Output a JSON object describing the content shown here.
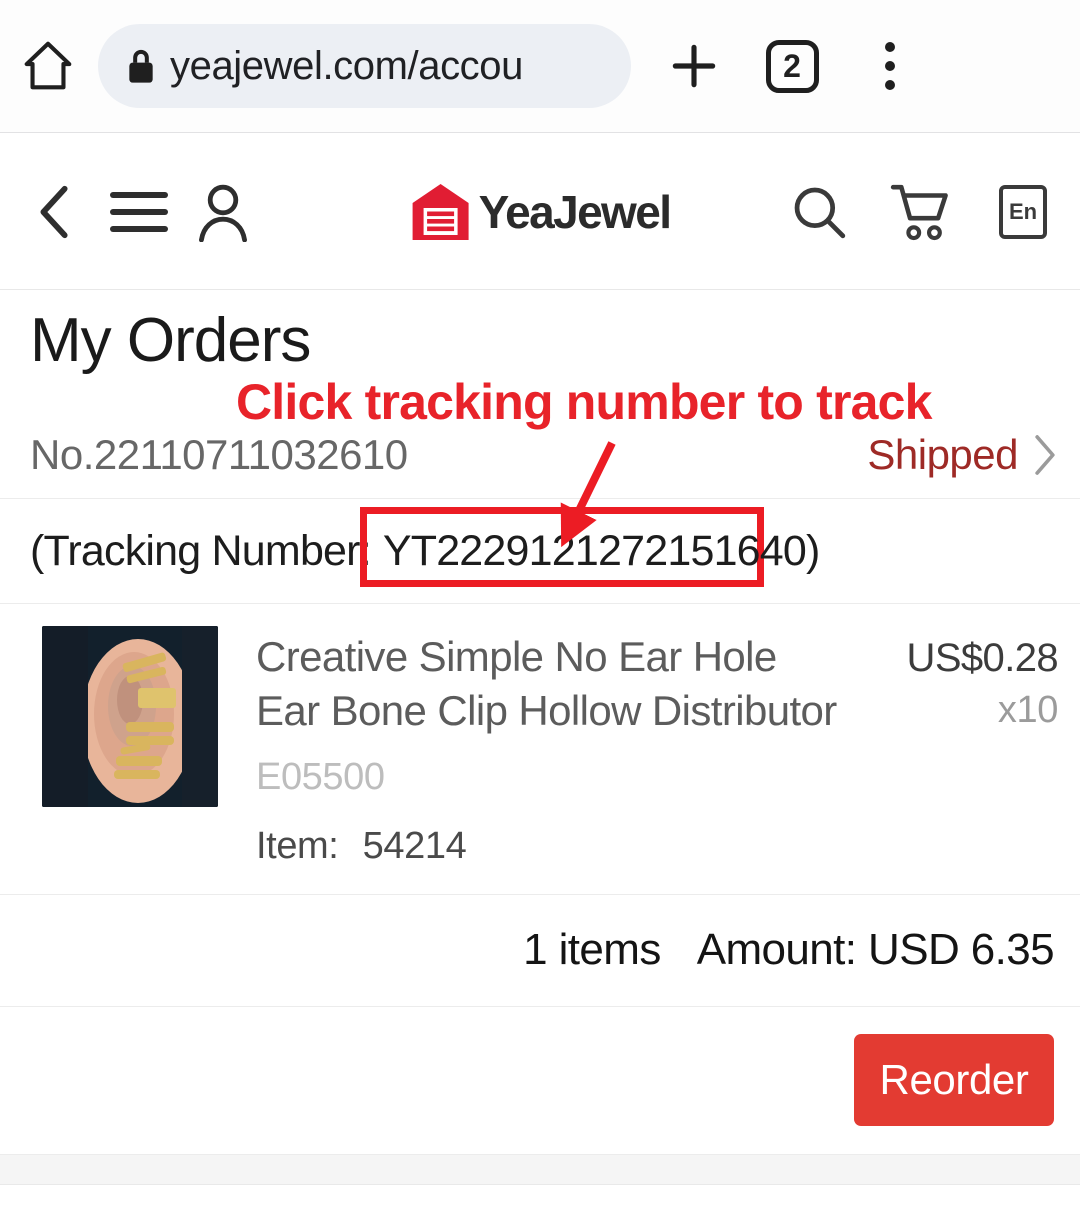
{
  "browser": {
    "home_icon": "home-icon",
    "lock_icon": "lock-icon",
    "url": "yeajewel.com/accou",
    "new_tab_icon": "plus-icon",
    "tab_count": "2",
    "menu_icon": "three-dots-icon"
  },
  "site_header": {
    "back_icon": "back-chevron-icon",
    "menu_icon": "hamburger-menu-icon",
    "account_icon": "user-account-icon",
    "logo_icon": "yeajewel-warehouse-logo-icon",
    "brand": "YeaJewel",
    "search_icon": "search-icon",
    "cart_icon": "shopping-cart-icon",
    "language": "En",
    "brand_red": "#e11d33"
  },
  "main": {
    "title": "My Orders",
    "annotation": "Click tracking number to track",
    "annotation_color": "#e8232a",
    "order": {
      "number": "No.22110711032610",
      "status": "Shipped",
      "status_color": "#9e2a26",
      "chevron_icon": "chevron-right-icon",
      "tracking_label": "(Tracking Number:",
      "tracking_number": "YT2229121272151640",
      "tracking_close": ")",
      "highlight_color": "#ec1c24"
    },
    "product": {
      "title": "Creative Simple No Ear Hole Ear Bone Clip Hollow Distributor",
      "sku": "E05500",
      "item_label": "Item:",
      "item_number": "54214",
      "price": "US$0.28",
      "quantity": "x10",
      "image_alt": "ear-cuff-product-photo"
    },
    "totals": {
      "items": "1 items",
      "amount": "Amount: USD 6.35"
    },
    "reorder_label": "Reorder",
    "reorder_color": "#e33b32"
  }
}
